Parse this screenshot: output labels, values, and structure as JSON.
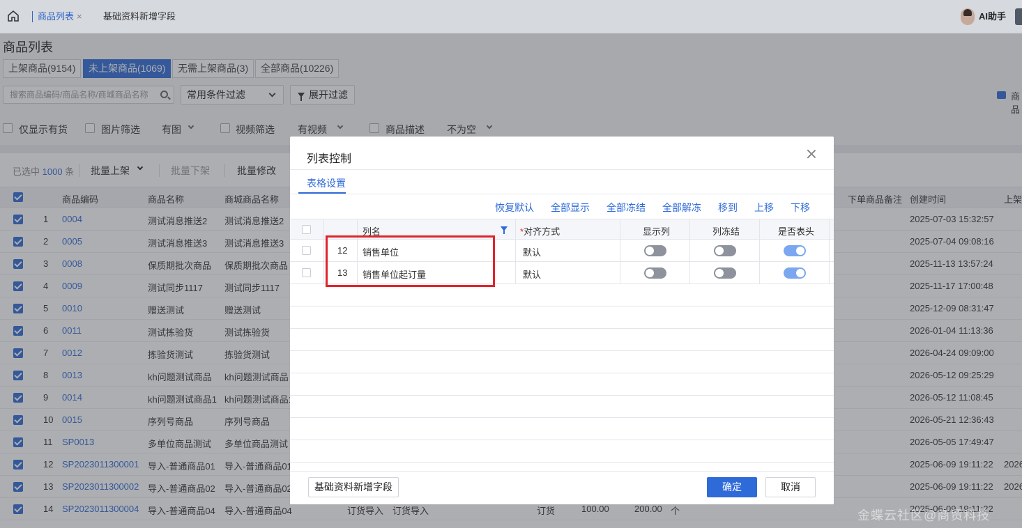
{
  "topbar": {
    "tab_active": "商品列表",
    "tab_close": "×",
    "tab_other": "基础资料新增字段",
    "ai_label": "AI助手"
  },
  "page": {
    "title": "商品列表",
    "segments": [
      "上架商品(9154)",
      "未上架商品(1069)",
      "无需上架商品(3)",
      "全部商品(10226)"
    ],
    "search_placeholder": "搜索商品编码/商品名称/商城商品名称",
    "filter_select": "常用条件过滤",
    "expand_filter": "展开过滤",
    "video_link": "商品"
  },
  "filters": {
    "only_stock": "仅显示有货",
    "image_filter": "图片筛选",
    "image_value": "有图",
    "video_filter": "视频筛选",
    "video_value": "有视频",
    "desc_filter": "商品描述",
    "desc_value": "不为空"
  },
  "toolbar": {
    "selected_prefix": "已选中",
    "selected_count": "1000",
    "selected_suffix": "条",
    "batch_on": "批量上架",
    "batch_off": "批量下架",
    "batch_edit": "批量修改"
  },
  "table": {
    "headers": [
      "商品编码",
      "商品名称",
      "商城商品名称",
      "下单商品备注",
      "创建时间",
      "上架"
    ],
    "rows": [
      {
        "no": "1",
        "code": "0004",
        "name": "测试消息推送2",
        "mall": "测试消息推送2",
        "time": "2025-07-03 15:32:57"
      },
      {
        "no": "2",
        "code": "0005",
        "name": "测试消息推送3",
        "mall": "测试消息推送3",
        "time": "2025-07-04 09:08:16"
      },
      {
        "no": "3",
        "code": "0008",
        "name": "保质期批次商品",
        "mall": "保质期批次商品",
        "time": "2025-11-13 13:57:24"
      },
      {
        "no": "4",
        "code": "0009",
        "name": "测试同步1117",
        "mall": "测试同步1117",
        "time": "2025-11-17 17:00:48"
      },
      {
        "no": "5",
        "code": "0010",
        "name": "赠送测试",
        "mall": "赠送测试",
        "time": "2025-12-09 08:31:47"
      },
      {
        "no": "6",
        "code": "0011",
        "name": "测试拣验货",
        "mall": "测试拣验货",
        "time": "2026-01-04 11:13:36"
      },
      {
        "no": "7",
        "code": "0012",
        "name": "拣验货测试",
        "mall": "拣验货测试",
        "time": "2026-04-24 09:09:00"
      },
      {
        "no": "8",
        "code": "0013",
        "name": "kh问题测试商品",
        "mall": "kh问题测试商品",
        "time": "2026-05-12 09:25:29"
      },
      {
        "no": "9",
        "code": "0014",
        "name": "kh问题测试商品1",
        "mall": "kh问题测试商品1",
        "time": "2026-05-12 11:08:45"
      },
      {
        "no": "10",
        "code": "0015",
        "name": "序列号商品",
        "mall": "序列号商品",
        "time": "2026-05-21 12:36:43"
      },
      {
        "no": "11",
        "code": "SP0013",
        "name": "多单位商品测试",
        "mall": "多单位商品测试",
        "time": "2026-05-05 17:49:47"
      },
      {
        "no": "12",
        "code": "SP2023011300001",
        "name": "导入-普通商品01",
        "mall": "导入-普通商品01",
        "time": "2025-06-09 19:11:22"
      },
      {
        "no": "13",
        "code": "SP2023011300002",
        "name": "导入-普通商品02",
        "mall": "导入-普通商品02",
        "time": "2025-06-09 19:11:22"
      },
      {
        "no": "14",
        "code": "SP2023011300004",
        "name": "导入-普通商品04",
        "mall": "导入-普通商品04",
        "time": "2025-06-09 19:11:22"
      }
    ],
    "row12_extra": "2026",
    "row13_extra": "2026",
    "row14_extra": [
      "订货导入",
      "订货导入",
      "订货",
      "100.00",
      "200.00",
      "个"
    ]
  },
  "dialog": {
    "title": "列表控制",
    "tab": "表格设置",
    "actions": [
      "恢复默认",
      "全部显示",
      "全部冻结",
      "全部解冻",
      "移到",
      "上移",
      "下移"
    ],
    "headers": {
      "col_name": "列名",
      "required_mark": "*",
      "align": "对齐方式",
      "show": "显示列",
      "freeze": "列冻结",
      "header": "是否表头"
    },
    "rows": [
      {
        "no": "12",
        "name": "销售单位",
        "align": "默认",
        "show": false,
        "freeze": false,
        "header": true
      },
      {
        "no": "13",
        "name": "销售单位起订量",
        "align": "默认",
        "show": false,
        "freeze": false,
        "header": true
      }
    ],
    "footer_left": "基础资料新增字段",
    "ok": "确定",
    "cancel": "取消"
  },
  "watermark": "金蝶云社区@商贸科技",
  "colors": {
    "accent": "#2f6bd8",
    "highlight": "#e0242c"
  }
}
